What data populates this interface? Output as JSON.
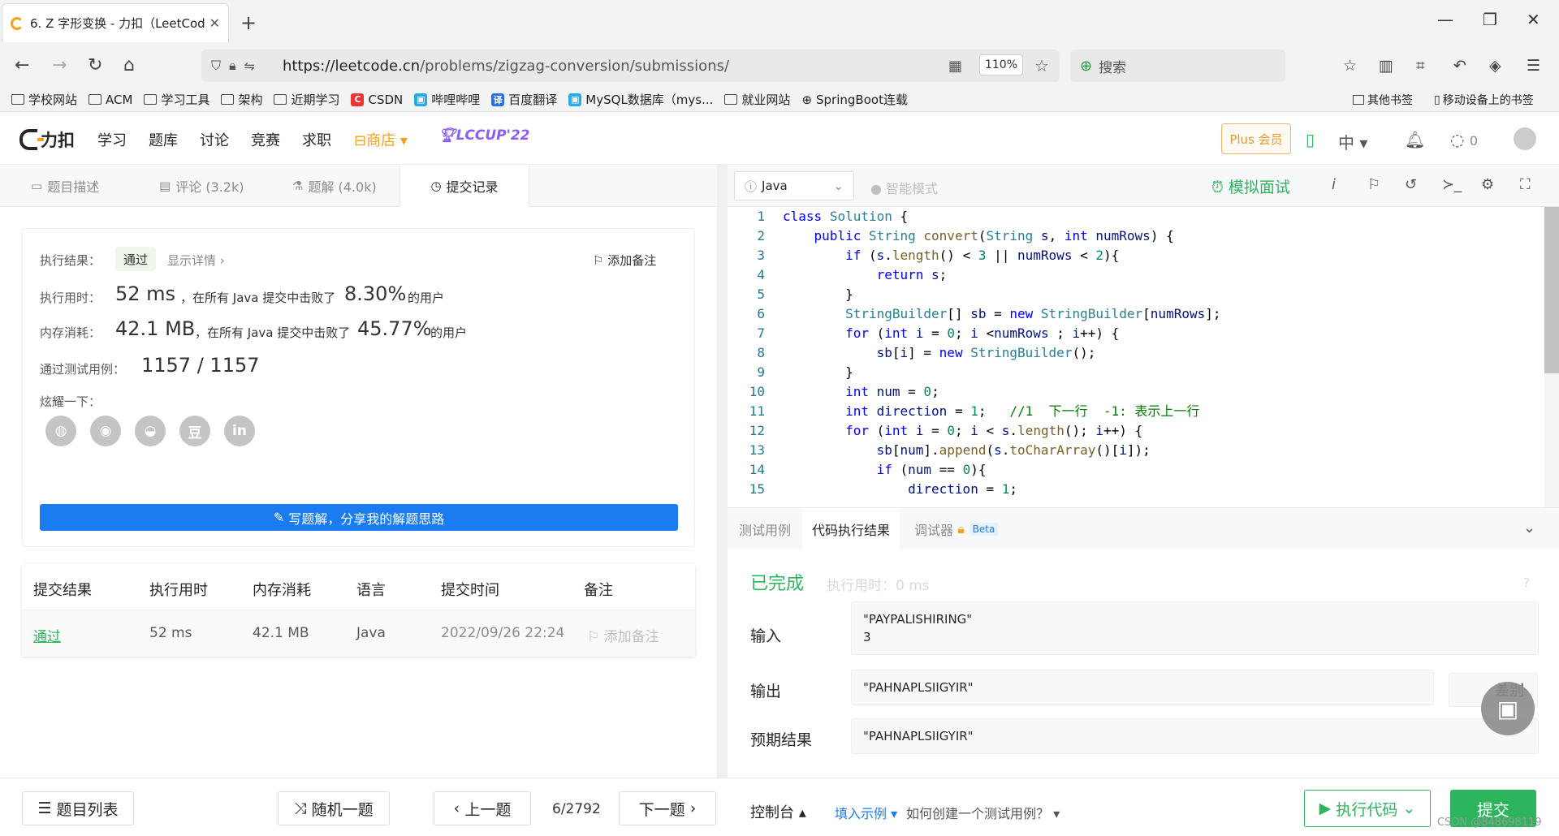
{
  "browser": {
    "tab_title": "6. Z 字形变换 - 力扣（LeetCod",
    "url_host": "https://leetcode.cn",
    "url_path": "/problems/zigzag-conversion/submissions/",
    "zoom": "110%",
    "search_placeholder": "搜索"
  },
  "bookmarks": [
    "学校网站",
    "ACM",
    "学习工具",
    "架构",
    "近期学习",
    "CSDN",
    "哔哩哔哩",
    "百度翻译",
    "MySQL数据库（mys...",
    "就业网站",
    "SpringBoot连载"
  ],
  "bookmarks_right": [
    "其他书签",
    "移动设备上的书签"
  ],
  "lc": {
    "logo": "力扣",
    "nav": [
      "学习",
      "题库",
      "讨论",
      "竞赛",
      "求职"
    ],
    "shop": "商店",
    "lccup": "LCCUP'22",
    "plus": "Plus 会员",
    "lang_toggle": "中",
    "likes": "0"
  },
  "left_tabs": [
    "题目描述",
    "评论 (3.2k)",
    "题解 (4.0k)",
    "提交记录"
  ],
  "result": {
    "exec_label": "执行结果：",
    "exec_value": "通过",
    "details": "显示详情",
    "add_note": "添加备注",
    "time_label": "执行用时：",
    "time_value": "52 ms",
    "time_mid": "，在所有 Java 提交中击败了",
    "time_pct": "8.30%",
    "users": "的用户",
    "mem_label": "内存消耗：",
    "mem_value": "42.1 MB",
    "mem_mid": "，在所有 Java 提交中击败了",
    "mem_pct": "45.77%",
    "tests_label": "通过测试用例：",
    "tests_value": "1157 / 1157",
    "share_label": "炫耀一下：",
    "write_btn": "写题解，分享我的解题思路"
  },
  "submissions": {
    "headers": [
      "提交结果",
      "执行用时",
      "内存消耗",
      "语言",
      "提交时间",
      "备注"
    ],
    "row": [
      "通过",
      "52 ms",
      "42.1 MB",
      "Java",
      "2022/09/26 22:24",
      "添加备注"
    ]
  },
  "editor_top": {
    "language": "Java",
    "smart": "智能模式",
    "mock": "模拟面试"
  },
  "code": [
    "class Solution {",
    "    public String convert(String s, int numRows) {",
    "        if (s.length() < 3 || numRows < 2){",
    "            return s;",
    "        }",
    "        StringBuilder[] sb = new StringBuilder[numRows];",
    "        for (int i = 0; i <numRows ; i++) {",
    "            sb[i] = new StringBuilder();",
    "        }",
    "        int num = 0;",
    "        int direction = 1;   //1  下一行  -1: 表示上一行",
    "        for (int i = 0; i < s.length(); i++) {",
    "            sb[num].append(s.toCharArray()[i]);",
    "            if (num == 0){",
    "                direction = 1;"
  ],
  "console_tabs": [
    "测试用例",
    "代码执行结果",
    "调试器",
    "Beta"
  ],
  "console": {
    "status": "已完成",
    "runtime": "执行用时：0 ms",
    "input_label": "输入",
    "input_line1": "\"PAYPALISHIRING\"",
    "input_line2": "3",
    "output_label": "输出",
    "output_value": "\"PAHNAPLSIIGYIR\"",
    "diff": "差别",
    "expected_label": "预期结果",
    "expected_value": "\"PAHNAPLSIIGYIR\""
  },
  "bottom": {
    "list": "题目列表",
    "random": "随机一题",
    "prev": "上一题",
    "page": "6/2792",
    "next": "下一题",
    "console": "控制台",
    "fill": "填入示例",
    "how": "如何创建一个测试用例？",
    "run": "执行代码",
    "submit": "提交"
  },
  "watermark": "CSDN @848698119"
}
